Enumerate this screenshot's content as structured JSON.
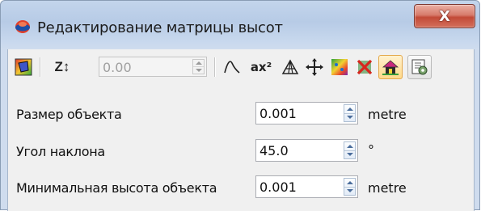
{
  "window": {
    "title": "Редактирование матрицы высот",
    "close_label": "X"
  },
  "toolbar": {
    "z_label": "Z↕",
    "z_value": "0.00",
    "ax2_label": "ax²",
    "icons": [
      "colored-polygon-icon",
      "z-level-icon",
      "curve-icon",
      "polynomial-icon",
      "triangulation-icon",
      "move-icon",
      "texture-icon",
      "delete-red-icon",
      "house-toggle-icon",
      "settings-icon"
    ]
  },
  "fields": [
    {
      "label": "Размер объекта",
      "value": "0.001",
      "unit": "metre"
    },
    {
      "label": "Угол наклона",
      "value": "45.0",
      "unit": "°"
    },
    {
      "label": "Минимальная высота объекта",
      "value": "0.001",
      "unit": "metre"
    }
  ],
  "colors": {
    "close_red": "#c24a37",
    "title_bar": "#b7cbe6",
    "client": "#f0f0f0",
    "toggle_orange": "#ffd98a"
  }
}
